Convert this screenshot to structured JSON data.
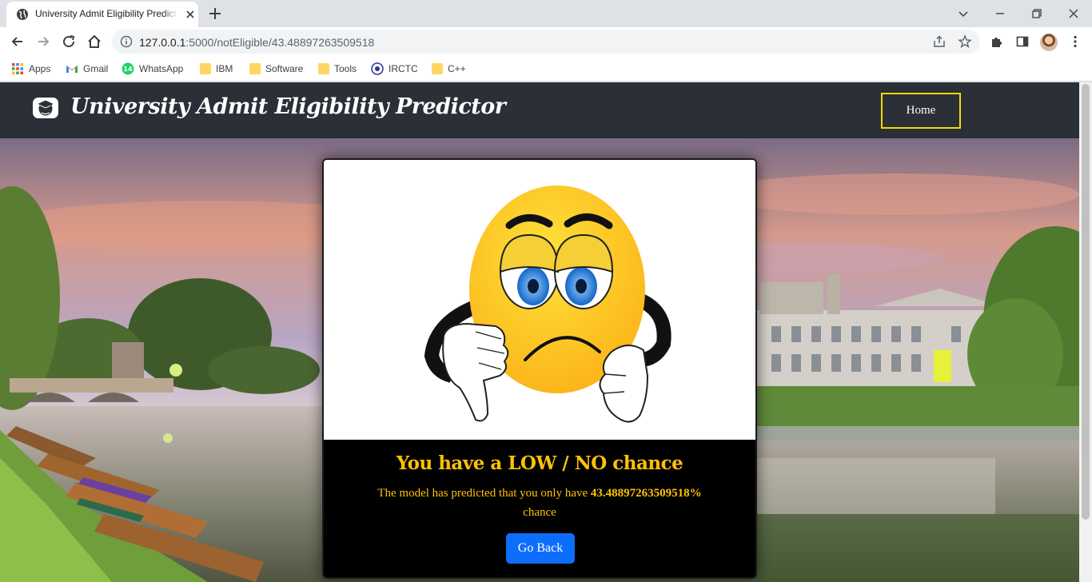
{
  "browser": {
    "tab_title": "University Admit Eligibility Predictor",
    "url_host": "127.0.0.1",
    "url_rest": ":5000/notEligible/43.48897263509518",
    "bookmarks": [
      {
        "label": "Apps",
        "icon": "apps-grid-icon"
      },
      {
        "label": "Gmail",
        "icon": "gmail-icon"
      },
      {
        "label": "WhatsApp",
        "icon": "whatsapp-icon",
        "badge": "14"
      },
      {
        "label": "IBM",
        "icon": "folder-icon"
      },
      {
        "label": "Software",
        "icon": "folder-icon"
      },
      {
        "label": "Tools",
        "icon": "folder-icon"
      },
      {
        "label": "IRCTC",
        "icon": "irctc-icon"
      },
      {
        "label": "C++",
        "icon": "folder-icon"
      }
    ]
  },
  "site": {
    "brand": "University Admit Eligibility Predictor",
    "nav_home": "Home"
  },
  "result": {
    "heading": "You have a LOW / NO chance",
    "text_before": "The model has predicted that you only have",
    "probability": "43.48897263509518%",
    "text_after": "chance",
    "go_back": "Go Back"
  },
  "colors": {
    "navbar": "#2a2f38",
    "accent_yellow": "#ffc107",
    "home_border": "#ffd700",
    "button_blue": "#0d6efd"
  }
}
